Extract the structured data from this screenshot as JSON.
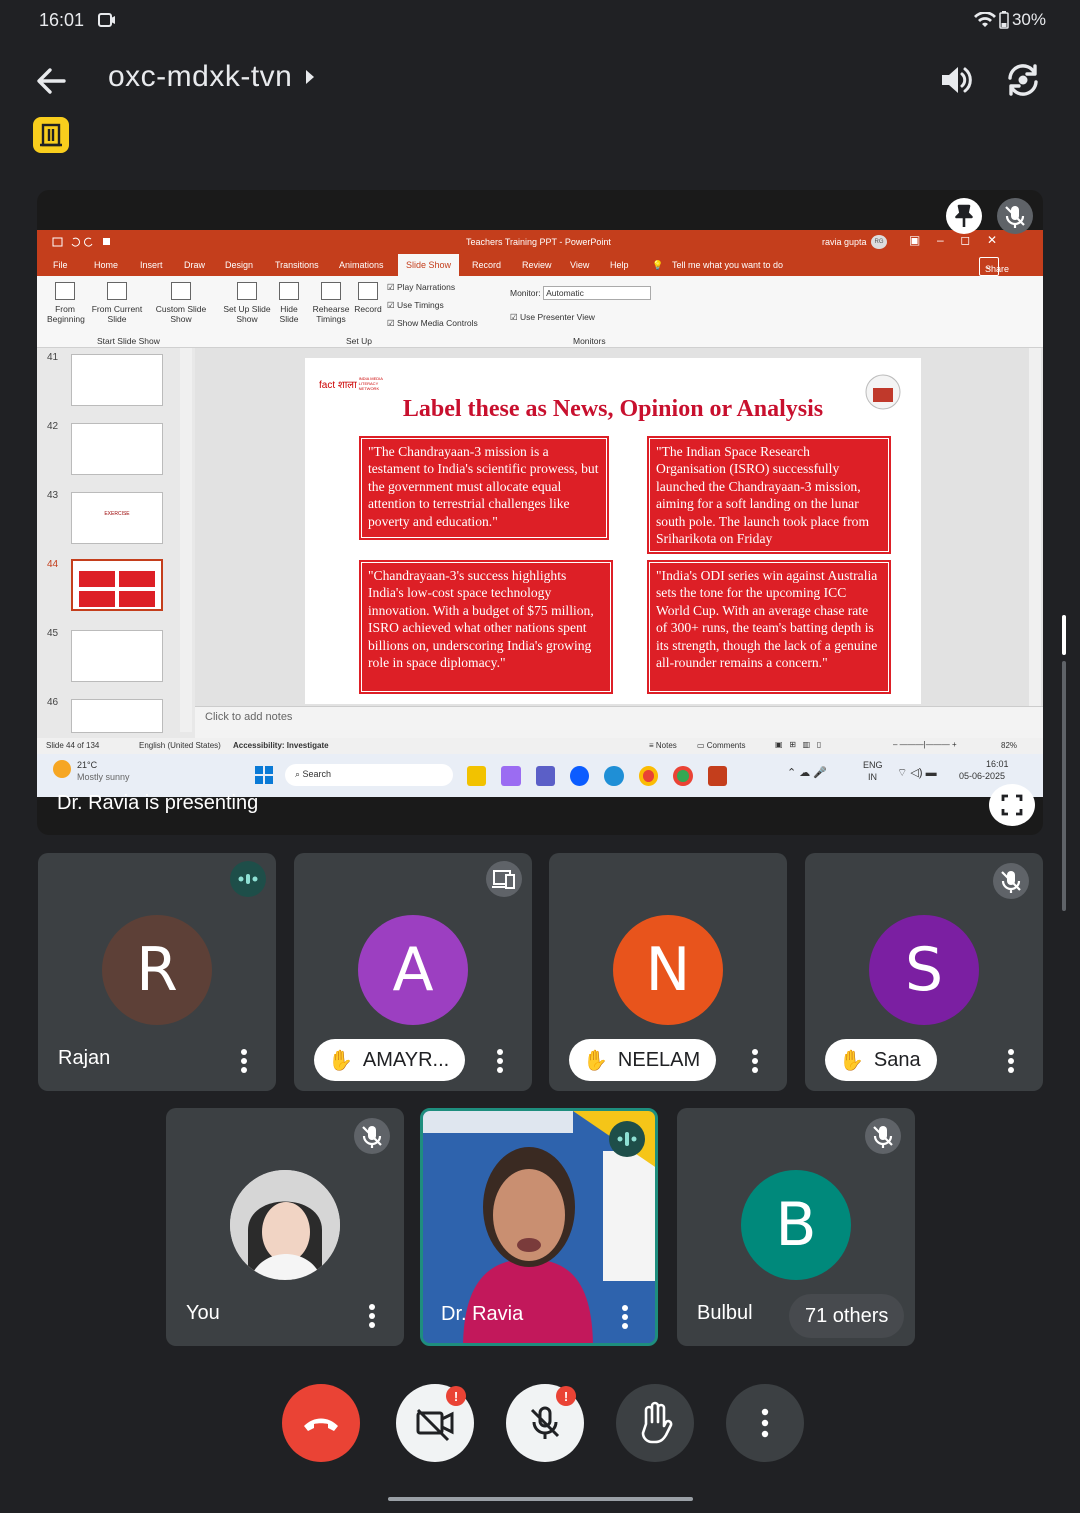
{
  "status_bar": {
    "time": "16:01",
    "battery": "30%"
  },
  "meeting": {
    "title": "oxc-mdxk-tvn"
  },
  "presentation": {
    "presenting_label": "Dr. Ravia is presenting",
    "powerpoint": {
      "window_title": "Teachers Training PPT  -  PowerPoint",
      "user": "ravia gupta",
      "user_initials": "RG",
      "share_label": "Share",
      "tabs": [
        "File",
        "Home",
        "Insert",
        "Draw",
        "Design",
        "Transitions",
        "Animations",
        "Slide Show",
        "Record",
        "Review",
        "View",
        "Help"
      ],
      "active_tab": "Slide Show",
      "tell_me": "Tell me what you want to do",
      "ribbon": {
        "from_beginning": "From Beginning",
        "from_current": "From Current Slide",
        "custom_show": "Custom Slide Show",
        "group_start": "Start Slide Show",
        "setup_show": "Set Up Slide Show",
        "hide_slide": "Hide Slide",
        "rehearse": "Rehearse Timings",
        "record": "Record",
        "play_narrations": "Play Narrations",
        "use_timings": "Use Timings",
        "show_media": "Show Media Controls",
        "group_setup": "Set Up",
        "monitor_label": "Monitor:",
        "monitor_value": "Automatic",
        "presenter_view": "Use Presenter View",
        "group_monitors": "Monitors"
      },
      "thumbnails": [
        "41",
        "42",
        "43",
        "44",
        "45",
        "46"
      ],
      "thumb43_text": "EXERCISE",
      "slide": {
        "title": "Label these as News, Opinion or Analysis",
        "logo_text": "fact शाला",
        "logo_sub": "INDIA MEDIA LITERACY NETWORK",
        "boxes": [
          "\"The Chandrayaan-3 mission is a testament to India's scientific prowess, but the government must allocate equal attention to terrestrial challenges like poverty and education.\"",
          "\"The Indian Space Research Organisation (ISRO) successfully launched the Chandrayaan-3 mission, aiming for a soft landing on the lunar south pole. The launch took place from Sriharikota on Friday",
          "\"Chandrayaan-3's success highlights India's low-cost space technology innovation. With a budget of $75 million, ISRO achieved what other nations spent billions on, underscoring India's growing role in space diplomacy.\"",
          "\"India's ODI series win against Australia sets the tone for the upcoming ICC World Cup. With an average chase rate of 300+ runs, the team's batting depth is its strength, though the lack of a genuine all-rounder remains a concern.\""
        ]
      },
      "notes_placeholder": "Click to add notes",
      "status": {
        "slide_count": "Slide 44 of 134",
        "language": "English (United States)",
        "accessibility": "Accessibility: Investigate",
        "notes": "Notes",
        "comments": "Comments",
        "zoom": "82%"
      },
      "taskbar": {
        "temp": "21°C",
        "weather": "Mostly sunny",
        "search": "Search",
        "lang": "ENG",
        "region": "IN",
        "clock": "16:01",
        "date": "05-06-2025"
      }
    }
  },
  "participants": [
    {
      "name": "Rajan",
      "initial": "R",
      "color": "#5d4037"
    },
    {
      "name": "AMAYR...",
      "initial": "A",
      "color": "#9c3fc1"
    },
    {
      "name": "NEELAM",
      "initial": "N",
      "color": "#e8541c"
    },
    {
      "name": "Sana",
      "initial": "S",
      "color": "#7b1fa2"
    },
    {
      "name": "You"
    },
    {
      "name": "Dr. Ravia"
    },
    {
      "name": "Bulbul",
      "initial": "B",
      "color": "#00897b",
      "others": "71 others"
    }
  ]
}
